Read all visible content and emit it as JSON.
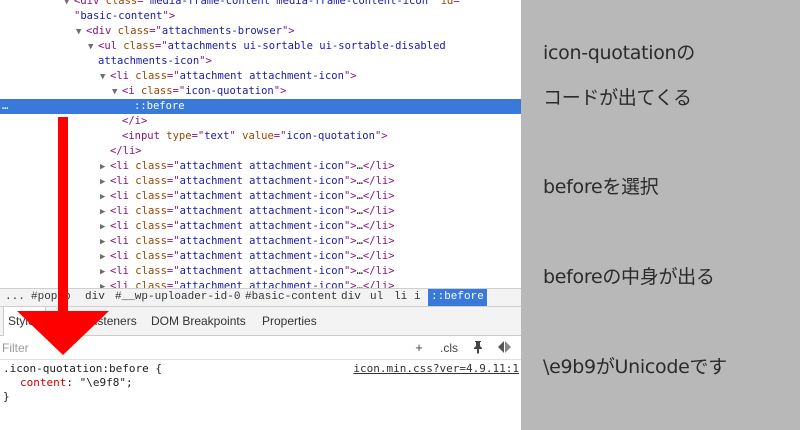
{
  "dom_tree": {
    "lines": [
      {
        "tri": "▼",
        "html": [
          [
            "tag",
            "<div "
          ],
          [
            "attr",
            "class"
          ],
          [
            "tag",
            "=\""
          ],
          [
            "val",
            "media-frame-content media-frame-content-icon"
          ],
          [
            "tag",
            "\" "
          ],
          [
            "attr",
            "id"
          ],
          [
            "tag",
            "="
          ]
        ]
      },
      {
        "tri": "",
        "html": [
          [
            "tag",
            "\""
          ],
          [
            "val",
            "basic-content"
          ],
          [
            "tag",
            "\">"
          ]
        ]
      },
      {
        "tri": "▼",
        "html": [
          [
            "tag",
            "<div "
          ],
          [
            "attr",
            "class"
          ],
          [
            "tag",
            "=\""
          ],
          [
            "val",
            "attachments-browser"
          ],
          [
            "tag",
            "\">"
          ]
        ]
      },
      {
        "tri": "▼",
        "html": [
          [
            "tag",
            "<ul "
          ],
          [
            "attr",
            "class"
          ],
          [
            "tag",
            "=\""
          ],
          [
            "val",
            "attachments ui-sortable ui-sortable-disabled"
          ]
        ]
      },
      {
        "tri": "",
        "html": [
          [
            "val",
            "attachments-icon"
          ],
          [
            "tag",
            "\">"
          ]
        ]
      },
      {
        "tri": "▼",
        "html": [
          [
            "tag",
            "<li "
          ],
          [
            "attr",
            "class"
          ],
          [
            "tag",
            "=\""
          ],
          [
            "val",
            "attachment attachment-icon"
          ],
          [
            "tag",
            "\">"
          ]
        ]
      },
      {
        "tri": "▼",
        "html": [
          [
            "tag",
            "<i "
          ],
          [
            "attr",
            "class"
          ],
          [
            "tag",
            "=\""
          ],
          [
            "val",
            "icon-quotation"
          ],
          [
            "tag",
            "\">"
          ]
        ]
      },
      {
        "tri": "",
        "html": [
          [
            "pseudo",
            "::before"
          ]
        ]
      },
      {
        "tri": "",
        "html": [
          [
            "tag",
            "</i>"
          ]
        ]
      },
      {
        "tri": "",
        "html": [
          [
            "tag",
            "<input "
          ],
          [
            "attr",
            "type"
          ],
          [
            "tag",
            "=\""
          ],
          [
            "val",
            "text"
          ],
          [
            "tag",
            "\" "
          ],
          [
            "attr",
            "value"
          ],
          [
            "tag",
            "=\""
          ],
          [
            "val",
            "icon-quotation"
          ],
          [
            "tag",
            "\">"
          ]
        ]
      },
      {
        "tri": "",
        "html": [
          [
            "tag",
            "</li>"
          ]
        ]
      },
      {
        "tri": "▶",
        "html": [
          [
            "tag",
            "<li "
          ],
          [
            "attr",
            "class"
          ],
          [
            "tag",
            "=\""
          ],
          [
            "val",
            "attachment attachment-icon"
          ],
          [
            "tag",
            "\">"
          ],
          [
            "txt",
            "…"
          ],
          [
            "tag",
            "</li>"
          ]
        ]
      },
      {
        "tri": "▶",
        "html": [
          [
            "tag",
            "<li "
          ],
          [
            "attr",
            "class"
          ],
          [
            "tag",
            "=\""
          ],
          [
            "val",
            "attachment attachment-icon"
          ],
          [
            "tag",
            "\">"
          ],
          [
            "txt",
            "…"
          ],
          [
            "tag",
            "</li>"
          ]
        ]
      },
      {
        "tri": "▶",
        "html": [
          [
            "tag",
            "<li "
          ],
          [
            "attr",
            "class"
          ],
          [
            "tag",
            "=\""
          ],
          [
            "val",
            "attachment attachment-icon"
          ],
          [
            "tag",
            "\">"
          ],
          [
            "txt",
            "…"
          ],
          [
            "tag",
            "</li>"
          ]
        ]
      },
      {
        "tri": "▶",
        "html": [
          [
            "tag",
            "<li "
          ],
          [
            "attr",
            "class"
          ],
          [
            "tag",
            "=\""
          ],
          [
            "val",
            "attachment attachment-icon"
          ],
          [
            "tag",
            "\">"
          ],
          [
            "txt",
            "…"
          ],
          [
            "tag",
            "</li>"
          ]
        ]
      },
      {
        "tri": "▶",
        "html": [
          [
            "tag",
            "<li "
          ],
          [
            "attr",
            "class"
          ],
          [
            "tag",
            "=\""
          ],
          [
            "val",
            "attachment attachment-icon"
          ],
          [
            "tag",
            "\">"
          ],
          [
            "txt",
            "…"
          ],
          [
            "tag",
            "</li>"
          ]
        ]
      },
      {
        "tri": "▶",
        "html": [
          [
            "tag",
            "<li "
          ],
          [
            "attr",
            "class"
          ],
          [
            "tag",
            "=\""
          ],
          [
            "val",
            "attachment attachment-icon"
          ],
          [
            "tag",
            "\">"
          ],
          [
            "txt",
            "…"
          ],
          [
            "tag",
            "</li>"
          ]
        ]
      },
      {
        "tri": "▶",
        "html": [
          [
            "tag",
            "<li "
          ],
          [
            "attr",
            "class"
          ],
          [
            "tag",
            "=\""
          ],
          [
            "val",
            "attachment attachment-icon"
          ],
          [
            "tag",
            "\">"
          ],
          [
            "txt",
            "…"
          ],
          [
            "tag",
            "</li>"
          ]
        ]
      },
      {
        "tri": "▶",
        "html": [
          [
            "tag",
            "<li "
          ],
          [
            "attr",
            "class"
          ],
          [
            "tag",
            "=\""
          ],
          [
            "val",
            "attachment attachment-icon"
          ],
          [
            "tag",
            "\">"
          ],
          [
            "txt",
            "…"
          ],
          [
            "tag",
            "</li>"
          ]
        ]
      },
      {
        "tri": "▶",
        "html": [
          [
            "tag",
            "<li "
          ],
          [
            "attr",
            "class"
          ],
          [
            "tag",
            "=\""
          ],
          [
            "val",
            "attachment attachment-icon"
          ],
          [
            "tag",
            "\">"
          ],
          [
            "txt",
            "…"
          ],
          [
            "tag",
            "</li>"
          ]
        ]
      },
      {
        "tri": "▶",
        "html": [
          [
            "tag",
            "<li "
          ],
          [
            "attr",
            "class"
          ],
          [
            "tag",
            "=\""
          ],
          [
            "val",
            "attachment attachment-icon"
          ],
          [
            "tag",
            "\">"
          ],
          [
            "txt",
            "…"
          ],
          [
            "tag",
            "</li>"
          ]
        ]
      }
    ],
    "selected_dots": "…"
  },
  "breadcrumb": {
    "items": [
      "...",
      "#popup",
      "div",
      "#__wp-uploader-id-0",
      "#basic-content",
      "div",
      "ul",
      "li",
      "i",
      "::before"
    ]
  },
  "tabs": [
    "Styles",
    "Event Listeners",
    "DOM Breakpoints",
    "Properties"
  ],
  "filter": {
    "placeholder": "Filter",
    "add_label": "+",
    "cls_label": ".cls"
  },
  "styles_rule": {
    "selector": ".icon-quotation:before {",
    "source": "icon.min.css?ver=4.9.11:1",
    "property": "content",
    "value": "\"\\e9f8\";",
    "close": "}"
  },
  "captions": [
    "icon-quotationの",
    "コードが出てくる",
    "beforeを選択",
    "beforeの中身が出る",
    "\\e9b9がUnicodeです"
  ],
  "colors": {
    "selection": "#3879d9",
    "arrow": "#ff0000",
    "caption_panel_bg": "#b8b8b8"
  }
}
